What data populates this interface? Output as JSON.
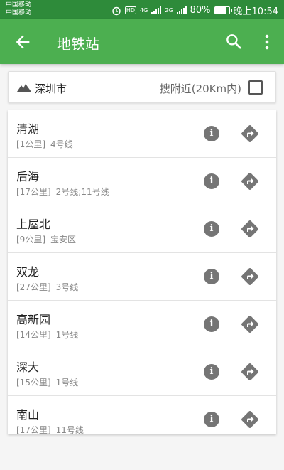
{
  "status_bar": {
    "carrier1": "中国移动",
    "carrier2": "中国移动",
    "hd": "HD",
    "net1": "4G",
    "net2": "2G",
    "battery_level": 0.8,
    "battery": "80%",
    "time": "晚上10:54"
  },
  "app_bar": {
    "title": "地铁站"
  },
  "filter": {
    "city": "深圳市",
    "nearby_label": "搜附近(20Km内)",
    "nearby_checked": false
  },
  "stations": [
    {
      "name": "清湖",
      "distance": "[1公里]",
      "info": "4号线"
    },
    {
      "name": "后海",
      "distance": "[17公里]",
      "info": "2号线;11号线"
    },
    {
      "name": "上屋北",
      "distance": "[9公里]",
      "info": "宝安区"
    },
    {
      "name": "双龙",
      "distance": "[27公里]",
      "info": "3号线"
    },
    {
      "name": "高新园",
      "distance": "[14公里]",
      "info": "1号线"
    },
    {
      "name": "深大",
      "distance": "[15公里]",
      "info": "1号线"
    },
    {
      "name": "南山",
      "distance": "[17公里]",
      "info": "11号线"
    }
  ],
  "colors": {
    "status_bar": "#2e8b3a",
    "app_bar": "#4caf50",
    "icon_gray": "#757575"
  },
  "icons": {
    "info": "i"
  }
}
